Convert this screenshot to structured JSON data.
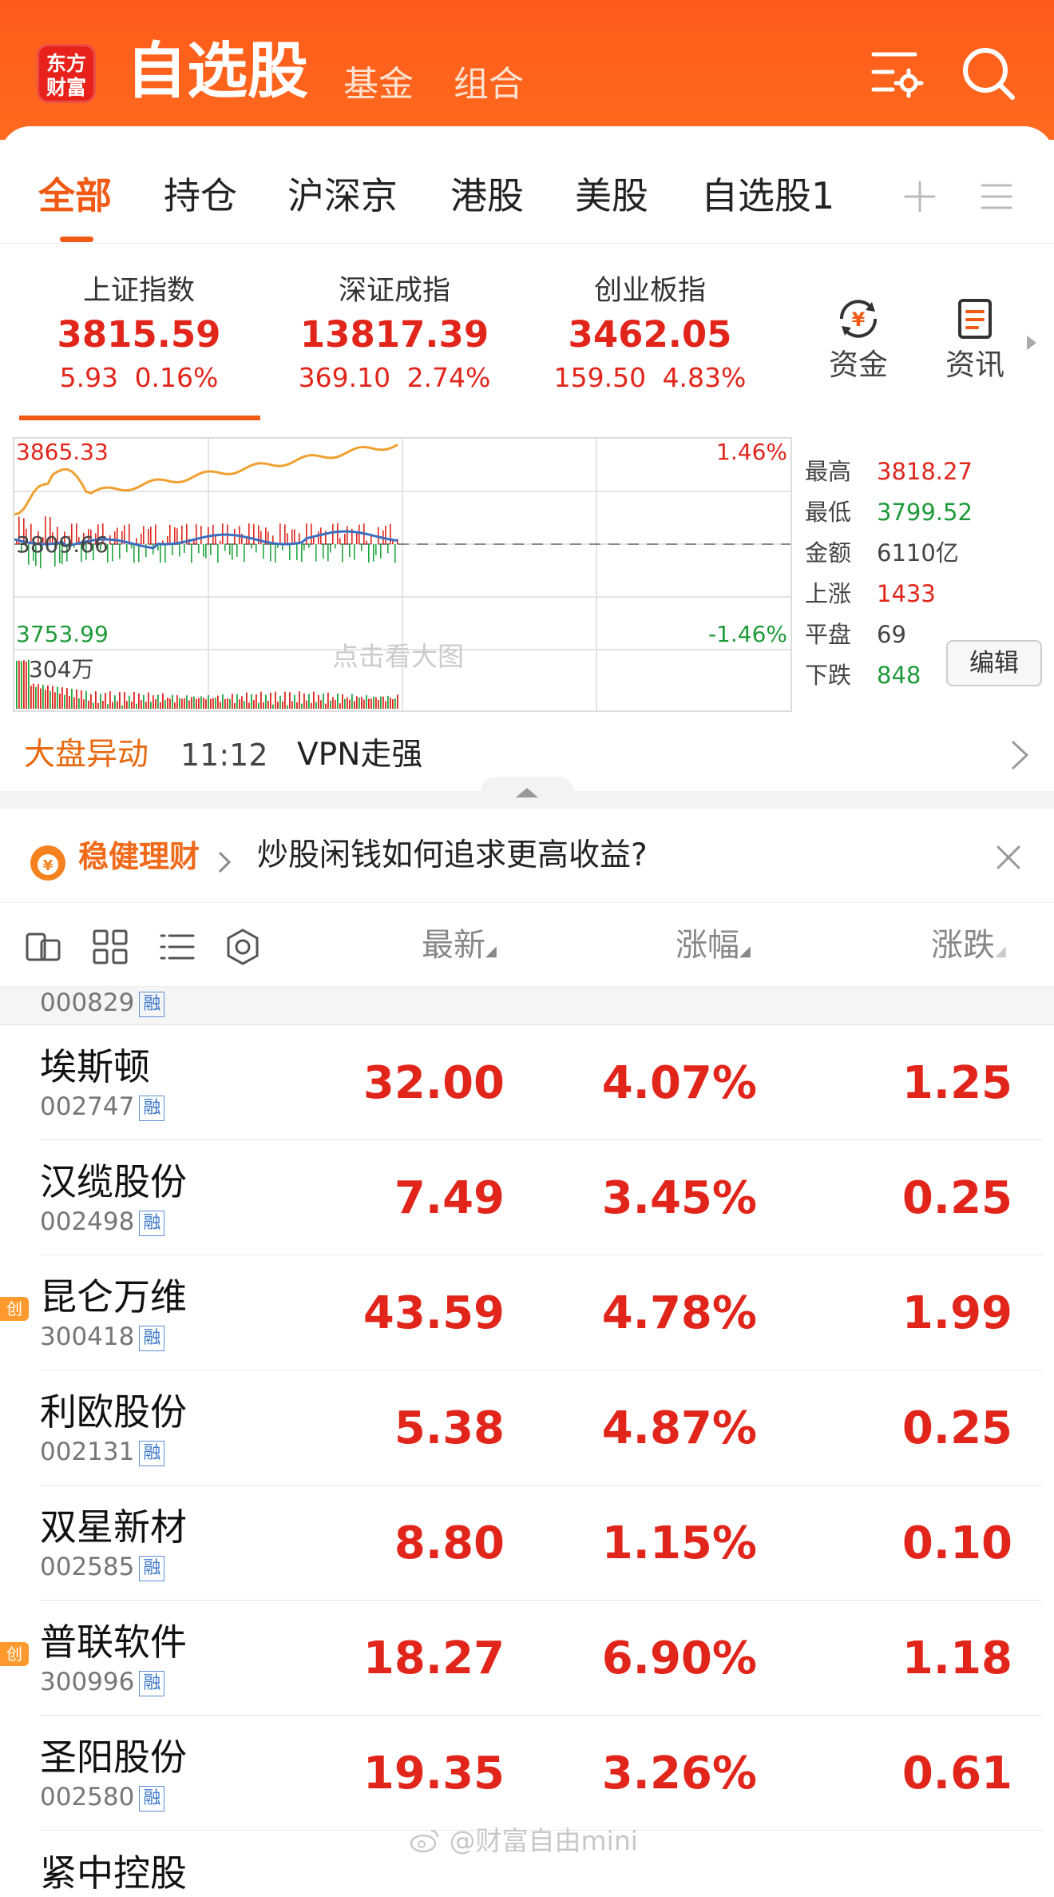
{
  "header": {
    "logo_line1": "东方",
    "logo_line2": "财富",
    "title": "自选股",
    "nav": [
      "基金",
      "组合"
    ],
    "icons": [
      "settings-list-icon",
      "search-icon"
    ],
    "color": "#ff5a1a"
  },
  "tabs": [
    "全部",
    "持仓",
    "沪深京",
    "港股",
    "美股",
    "自选股1"
  ],
  "indices": [
    {
      "name": "上证指数",
      "value": "3815.59",
      "change": "5.93",
      "pct": "0.16%"
    },
    {
      "name": "深证成指",
      "value": "13817.39",
      "change": "369.10",
      "pct": "2.74%"
    },
    {
      "name": "创业板指",
      "value": "3462.05",
      "change": "159.50",
      "pct": "4.83%"
    }
  ],
  "quick_actions": [
    {
      "label": "资金",
      "icon": "fund-flow-icon"
    },
    {
      "label": "资讯",
      "icon": "news-icon"
    }
  ],
  "chart": {
    "high_label": "3865.33",
    "mid_label": "3809.66",
    "low_label": "3753.99",
    "up_pct": "1.46%",
    "down_pct": "-1.46%",
    "volume_label": "304万",
    "hint": "点击看大图"
  },
  "stats": [
    {
      "k": "最高",
      "v": "3818.27",
      "tone": "red"
    },
    {
      "k": "最低",
      "v": "3799.52",
      "tone": "green"
    },
    {
      "k": "金额",
      "v": "6110亿",
      "tone": "gray"
    },
    {
      "k": "上涨",
      "v": "1433",
      "tone": "red"
    },
    {
      "k": "平盘",
      "v": "69",
      "tone": "gray"
    },
    {
      "k": "下跌",
      "v": "848",
      "tone": "green"
    }
  ],
  "edit_label": "编辑",
  "market_move": {
    "title": "大盘异动",
    "time": "11:12",
    "text": "VPN走强"
  },
  "banner": {
    "brand": "稳健理财",
    "text": "炒股闲钱如何追求更高收益?"
  },
  "list_header": {
    "latest": "最新",
    "pct": "涨幅",
    "change": "涨跌"
  },
  "partial_code": "000829",
  "rong_badge": "融",
  "chuang_badge": "创",
  "stocks": [
    {
      "name": "埃斯顿",
      "code": "002747",
      "price": "32.00",
      "pct": "4.07%",
      "change": "1.25",
      "chuang": false
    },
    {
      "name": "汉缆股份",
      "code": "002498",
      "price": "7.49",
      "pct": "3.45%",
      "change": "0.25",
      "chuang": false
    },
    {
      "name": "昆仑万维",
      "code": "300418",
      "price": "43.59",
      "pct": "4.78%",
      "change": "1.99",
      "chuang": true
    },
    {
      "name": "利欧股份",
      "code": "002131",
      "price": "5.38",
      "pct": "4.87%",
      "change": "0.25",
      "chuang": false
    },
    {
      "name": "双星新材",
      "code": "002585",
      "price": "8.80",
      "pct": "1.15%",
      "change": "0.10",
      "chuang": false
    },
    {
      "name": "普联软件",
      "code": "300996",
      "price": "18.27",
      "pct": "6.90%",
      "change": "1.18",
      "chuang": true
    },
    {
      "name": "圣阳股份",
      "code": "002580",
      "price": "19.35",
      "pct": "3.26%",
      "change": "0.61",
      "chuang": false
    }
  ],
  "bottom_partial_name": "紧中控股",
  "watermark": "@财富自由mini"
}
